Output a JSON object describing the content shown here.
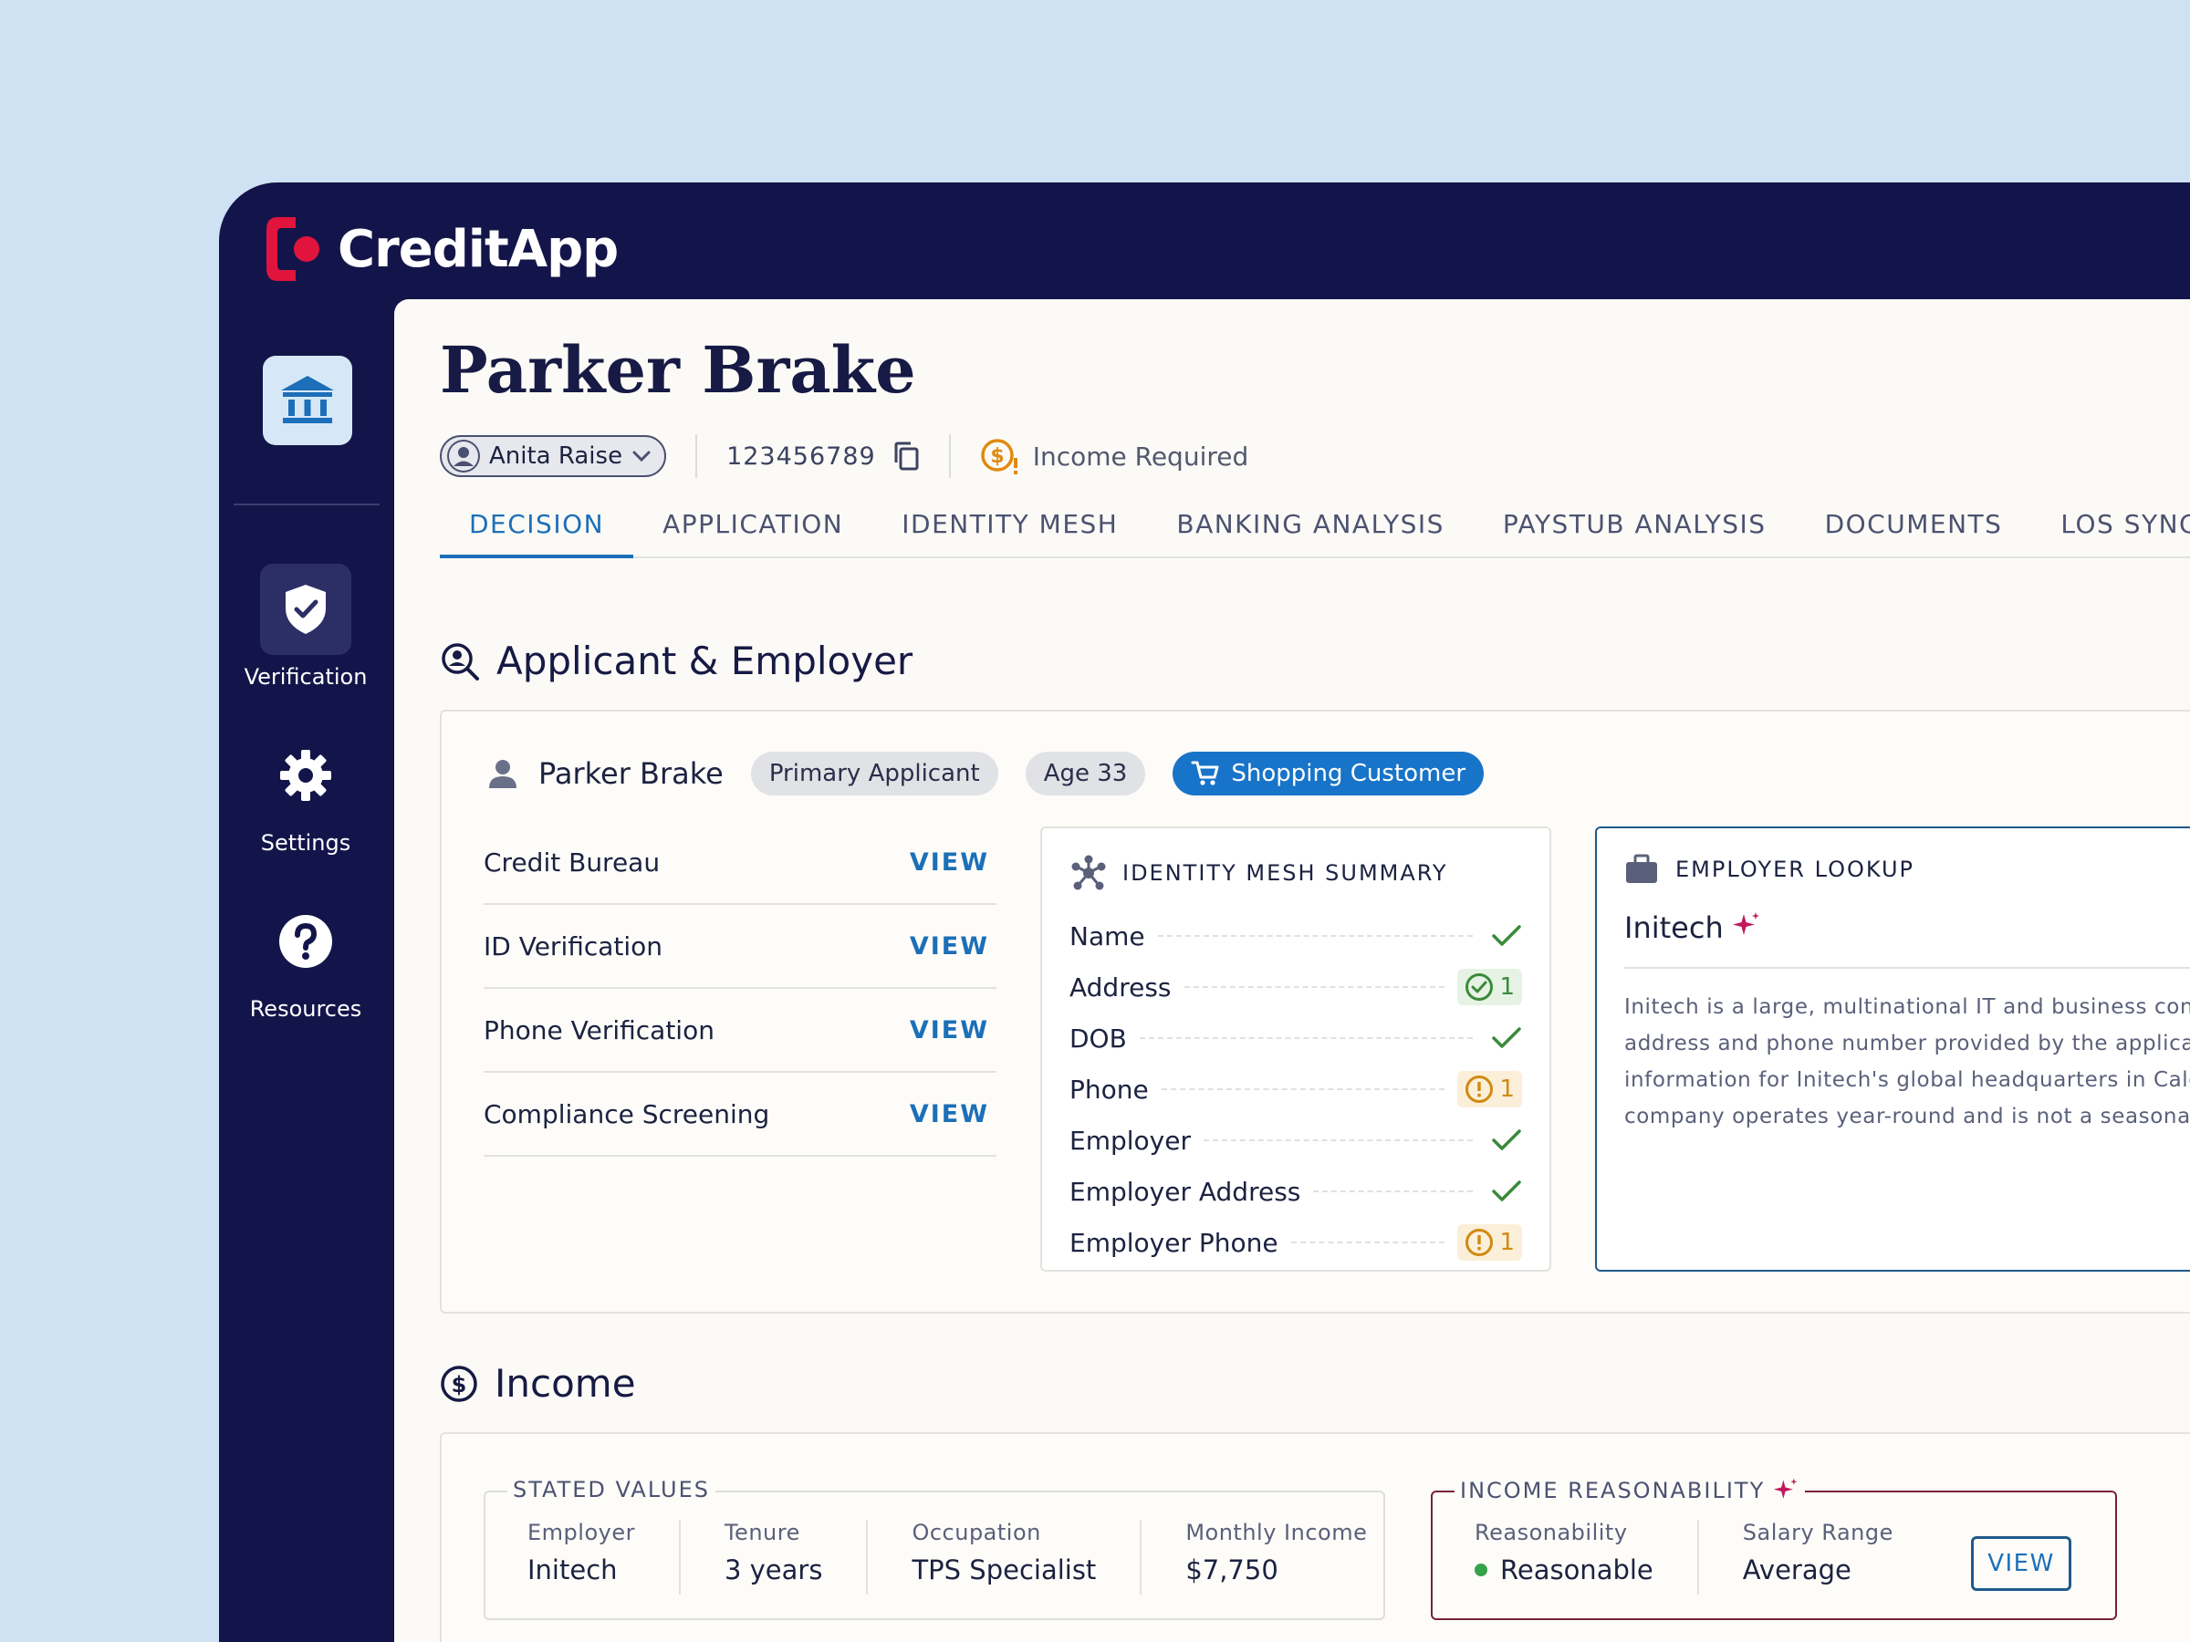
{
  "app": {
    "brand": "CreditApp"
  },
  "sidebar": {
    "items": [
      {
        "label": "Verification"
      },
      {
        "label": "Settings"
      },
      {
        "label": "Resources"
      }
    ]
  },
  "header": {
    "applicant_title": "Parker Brake",
    "assignee": "Anita Raise",
    "account_number": "123456789",
    "status": "Income Required"
  },
  "tabs": [
    "DECISION",
    "APPLICATION",
    "IDENTITY MESH",
    "BANKING ANALYSIS",
    "PAYSTUB ANALYSIS",
    "DOCUMENTS",
    "LOS SYNC"
  ],
  "applicant_section": {
    "heading": "Applicant & Employer",
    "name": "Parker Brake",
    "chips": {
      "role": "Primary Applicant",
      "age": "Age 33",
      "segment": "Shopping Customer"
    },
    "checks": [
      {
        "label": "Credit Bureau",
        "action": "VIEW"
      },
      {
        "label": "ID Verification",
        "action": "VIEW"
      },
      {
        "label": "Phone Verification",
        "action": "VIEW"
      },
      {
        "label": "Compliance Screening",
        "action": "VIEW"
      }
    ],
    "identity_mesh": {
      "heading": "IDENTITY MESH SUMMARY",
      "rows": [
        {
          "label": "Name",
          "status": "ok",
          "count": ""
        },
        {
          "label": "Address",
          "status": "ok-badge",
          "count": "1"
        },
        {
          "label": "DOB",
          "status": "ok",
          "count": ""
        },
        {
          "label": "Phone",
          "status": "warn",
          "count": "1"
        },
        {
          "label": "Employer",
          "status": "ok",
          "count": ""
        },
        {
          "label": "Employer Address",
          "status": "ok",
          "count": ""
        },
        {
          "label": "Employer Phone",
          "status": "warn",
          "count": "1"
        }
      ]
    },
    "employer_lookup": {
      "heading": "EMPLOYER LOOKUP",
      "name": "Initech",
      "description_lines": [
        "Initech is a large, multinational IT and business cons",
        "address and phone number provided by the applica",
        "information for Initech's global headquarters in Calg",
        "company operates year-round and is not a seasonal"
      ]
    }
  },
  "income_section": {
    "heading": "Income",
    "stated_values": {
      "legend": "STATED VALUES",
      "fields": [
        {
          "label": "Employer",
          "value": "Initech"
        },
        {
          "label": "Tenure",
          "value": "3 years"
        },
        {
          "label": "Occupation",
          "value": "TPS Specialist"
        },
        {
          "label": "Monthly Income",
          "value": "$7,750"
        }
      ]
    },
    "reasonability": {
      "legend": "INCOME REASONABILITY",
      "fields": [
        {
          "label": "Reasonability",
          "value": "Reasonable"
        },
        {
          "label": "Salary Range",
          "value": "Average"
        }
      ],
      "action": "VIEW"
    }
  },
  "colors": {
    "navy": "#13154a",
    "accent_blue": "#1c6fb8",
    "brand_red": "#e0143c",
    "ok_green": "#3a8a3a",
    "warn_orange": "#d08a10"
  }
}
